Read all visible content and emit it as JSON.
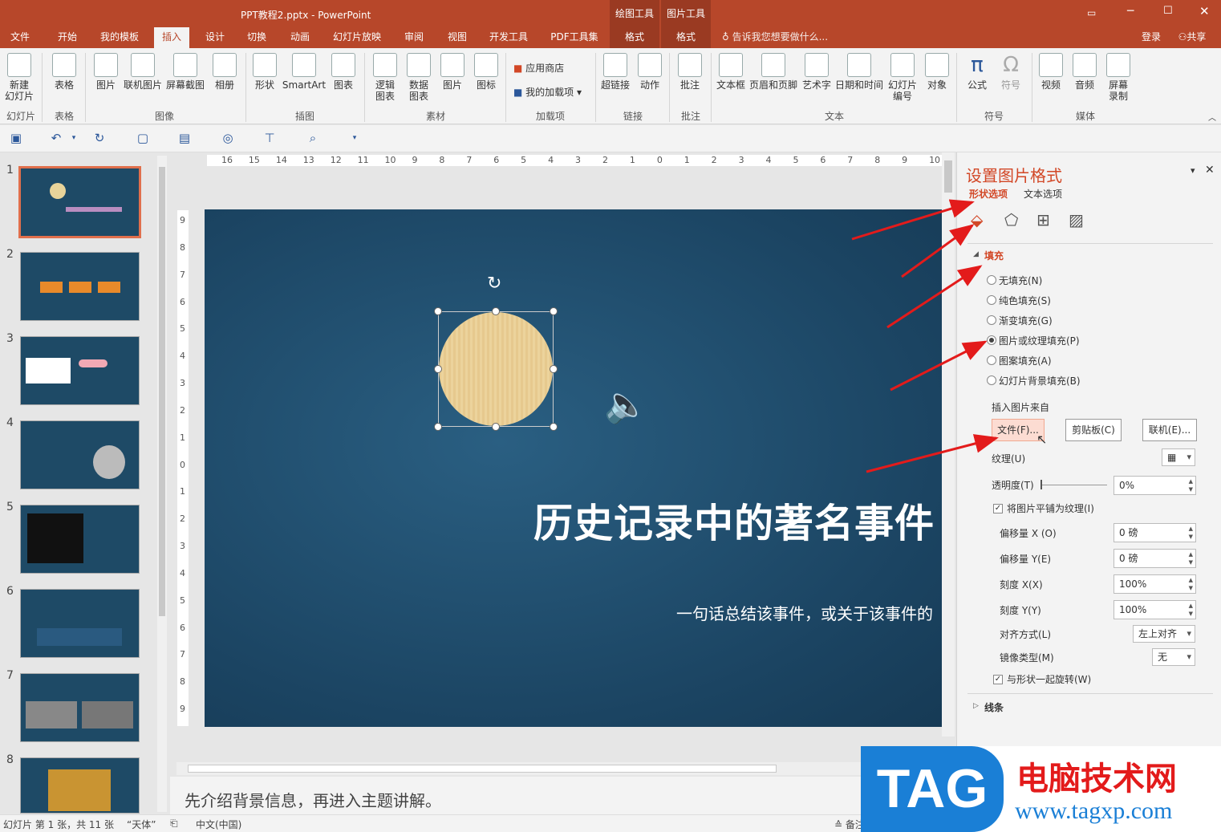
{
  "title": {
    "doc": "PPT教程2.pptx - PowerPoint",
    "ctx1": "绘图工具",
    "ctx2": "图片工具",
    "login": "登录",
    "share": "共享",
    "tell_me": "告诉我您想要做什么..."
  },
  "tabs": [
    "文件",
    "开始",
    "我的模板",
    "插入",
    "设计",
    "切换",
    "动画",
    "幻灯片放映",
    "审阅",
    "视图",
    "开发工具",
    "PDF工具集",
    "格式",
    "格式"
  ],
  "ribbon": {
    "buttons": [
      "新建\n幻灯片",
      "表格",
      "图片",
      "联机图片",
      "屏幕截图",
      "相册",
      "形状",
      "SmartArt",
      "图表",
      "逻辑\n图表",
      "数据\n图表",
      "图片",
      "图标",
      "应用商店",
      "我的加载项",
      "超链接",
      "动作",
      "批注",
      "文本框",
      "页眉和页脚",
      "艺术字",
      "日期和时间",
      "幻灯片\n编号",
      "对象",
      "公式",
      "符号",
      "视频",
      "音频",
      "屏幕\n录制"
    ],
    "groups": [
      "幻灯片",
      "表格",
      "图像",
      "插图",
      "素材",
      "加载项",
      "链接",
      "批注",
      "文本",
      "符号",
      "媒体"
    ]
  },
  "slide": {
    "title": "历史记录中的著名事件",
    "subtitle": "一句话总结该事件，或关于该事件的"
  },
  "notes": "先介绍背景信息，再进入主题讲解。",
  "status": {
    "slide_info": "幻灯片 第 1 张，共 11 张",
    "theme": "“天体”",
    "lang": "中文(中国)",
    "notes_label": "备注"
  },
  "thumbnails": [
    "1",
    "2",
    "3",
    "4",
    "5",
    "6",
    "7",
    "8"
  ],
  "ruler": {
    "h": [
      "16",
      "15",
      "14",
      "13",
      "12",
      "11",
      "10",
      "9",
      "8",
      "7",
      "6",
      "5",
      "4",
      "3",
      "2",
      "1",
      "0",
      "1",
      "2",
      "3",
      "4",
      "5",
      "6",
      "7",
      "8",
      "9",
      "10"
    ],
    "v": [
      "9",
      "8",
      "7",
      "6",
      "5",
      "4",
      "3",
      "2",
      "1",
      "0",
      "1",
      "2",
      "3",
      "4",
      "5",
      "6",
      "7",
      "8",
      "9"
    ]
  },
  "panel": {
    "title": "设置图片格式",
    "tab_shape": "形状选项",
    "tab_text": "文本选项",
    "fill_header": "填充",
    "fill_options": [
      "无填充(N)",
      "纯色填充(S)",
      "渐变填充(G)",
      "图片或纹理填充(P)",
      "图案填充(A)",
      "幻灯片背景填充(B)"
    ],
    "insert_from": "插入图片来自",
    "btn_file": "文件(F)...",
    "btn_clipboard": "剪贴板(C)",
    "btn_online": "联机(E)...",
    "texture": "纹理(U)",
    "transparency": "透明度(T)",
    "transparency_val": "0%",
    "tile": "将图片平铺为纹理(I)",
    "offset_x": "偏移量 X (O)",
    "offset_x_val": "0 磅",
    "offset_y": "偏移量 Y(E)",
    "offset_y_val": "0 磅",
    "scale_x": "刻度 X(X)",
    "scale_x_val": "100%",
    "scale_y": "刻度 Y(Y)",
    "scale_y_val": "100%",
    "align": "对齐方式(L)",
    "align_val": "左上对齐",
    "mirror": "镜像类型(M)",
    "mirror_val": "无",
    "rotate": "与形状一起旋转(W)",
    "line": "线条"
  },
  "watermark": {
    "tag": "TAG",
    "cn": "电脑技术网",
    "url": "www.tagxp.com"
  }
}
